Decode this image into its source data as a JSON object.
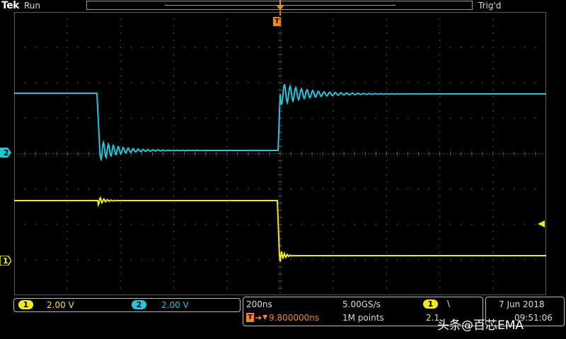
{
  "header": {
    "brand": "Tek",
    "acq_state": "Run",
    "trigger_state": "Trig'd",
    "trigger_marker_label": "T"
  },
  "channels": [
    {
      "id": "1",
      "scale": "2.00 V",
      "color": "#f2e81e"
    },
    {
      "id": "2",
      "scale": "2.00 V",
      "color": "#21c6dc"
    }
  ],
  "horizontal": {
    "time_per_div": "200ns",
    "trigger_position": "9.800000ns",
    "sample_rate": "5.00GS/s",
    "record_length": "1M points"
  },
  "trigger": {
    "source": "1",
    "slope_symbol": "\\",
    "level": "2.1"
  },
  "datetime": {
    "date": "7 Jun  2018",
    "time": "09:51:06"
  },
  "watermark": "头条@百芯EMA",
  "colors": {
    "ch1": "#f2e81e",
    "ch2": "#21c6dc",
    "trigger": "#f08a1e",
    "grid": "#5a5a5a"
  },
  "icons": [
    "trigger-position-icon",
    "channel-ground-marker-icon",
    "trigger-level-icon",
    "arrow-icon",
    "falling-slope-icon"
  ]
}
